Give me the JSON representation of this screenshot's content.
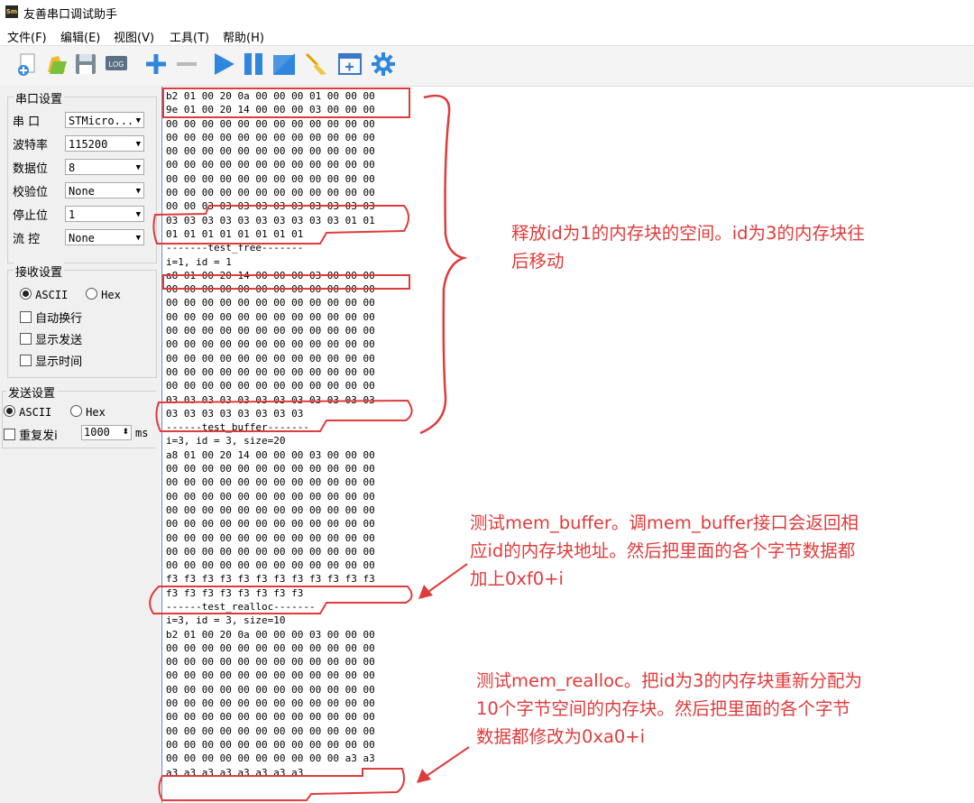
{
  "window": {
    "title": "友善串口调试助手",
    "icon_text": "Sm"
  },
  "menu": [
    "文件(F)",
    "编辑(E)",
    "视图(V)",
    "工具(T)",
    "帮助(H)"
  ],
  "toolbar": [
    "new-icon",
    "open-icon",
    "save-icon",
    "log-icon",
    "add-icon",
    "remove-icon",
    "play-icon",
    "pause-icon",
    "stop-icon",
    "clear-icon",
    "window-icon",
    "settings-icon"
  ],
  "toolbar_log_text": "LOG",
  "serial_settings": {
    "title": "串口设置",
    "rows": [
      {
        "label": "串  口",
        "value": "STMicro..."
      },
      {
        "label": "波特率",
        "value": "115200"
      },
      {
        "label": "数据位",
        "value": "8"
      },
      {
        "label": "校验位",
        "value": "None"
      },
      {
        "label": "停止位",
        "value": "1"
      },
      {
        "label": "流  控",
        "value": "None"
      }
    ]
  },
  "receive_settings": {
    "title": "接收设置",
    "ascii": "ASCII",
    "hex": "Hex",
    "auto_newline": "自动换行",
    "show_send": "显示发送",
    "show_time": "显示时间"
  },
  "send_settings": {
    "title": "发送设置",
    "ascii": "ASCII",
    "hex": "Hex",
    "repeat": "重复发i",
    "interval": "1000",
    "unit": "ms"
  },
  "output_lines": [
    "b2 01 00 20 0a 00 00 00 01 00 00 00",
    "9e 01 00 20 14 00 00 00 03 00 00 00",
    "00 00 00 00 00 00 00 00 00 00 00 00",
    "00 00 00 00 00 00 00 00 00 00 00 00",
    "00 00 00 00 00 00 00 00 00 00 00 00",
    "00 00 00 00 00 00 00 00 00 00 00 00",
    "00 00 00 00 00 00 00 00 00 00 00 00",
    "00 00 00 00 00 00 00 00 00 00 00 00",
    "00 00 03 03 03 03 03 03 03 03 03 03",
    "03 03 03 03 03 03 03 03 03 03 01 01",
    "01 01 01 01 01 01 01 01",
    "-------test_free-------",
    "i=1, id = 1",
    "a8 01 00 20 14 00 00 00 03 00 00 00",
    "00 00 00 00 00 00 00 00 00 00 00 00",
    "00 00 00 00 00 00 00 00 00 00 00 00",
    "00 00 00 00 00 00 00 00 00 00 00 00",
    "00 00 00 00 00 00 00 00 00 00 00 00",
    "00 00 00 00 00 00 00 00 00 00 00 00",
    "00 00 00 00 00 00 00 00 00 00 00 00",
    "00 00 00 00 00 00 00 00 00 00 00 00",
    "00 00 00 00 00 00 00 00 00 00 00 00",
    "03 03 03 03 03 03 03 03 03 03 03 03",
    "03 03 03 03 03 03 03 03",
    "------test_buffer-------",
    "i=3, id = 3, size=20",
    "a8 01 00 20 14 00 00 00 03 00 00 00",
    "00 00 00 00 00 00 00 00 00 00 00 00",
    "00 00 00 00 00 00 00 00 00 00 00 00",
    "00 00 00 00 00 00 00 00 00 00 00 00",
    "00 00 00 00 00 00 00 00 00 00 00 00",
    "00 00 00 00 00 00 00 00 00 00 00 00",
    "00 00 00 00 00 00 00 00 00 00 00 00",
    "00 00 00 00 00 00 00 00 00 00 00 00",
    "00 00 00 00 00 00 00 00 00 00 00 00",
    "f3 f3 f3 f3 f3 f3 f3 f3 f3 f3 f3 f3",
    "f3 f3 f3 f3 f3 f3 f3 f3",
    "------test_realloc-------",
    "i=3, id = 3, size=10",
    "b2 01 00 20 0a 00 00 00 03 00 00 00",
    "00 00 00 00 00 00 00 00 00 00 00 00",
    "00 00 00 00 00 00 00 00 00 00 00 00",
    "00 00 00 00 00 00 00 00 00 00 00 00",
    "00 00 00 00 00 00 00 00 00 00 00 00",
    "00 00 00 00 00 00 00 00 00 00 00 00",
    "00 00 00 00 00 00 00 00 00 00 00 00",
    "00 00 00 00 00 00 00 00 00 00 00 00",
    "00 00 00 00 00 00 00 00 00 00 00 00",
    "00 00 00 00 00 00 00 00 00 00 a3 a3",
    "a3 a3 a3 a3 a3 a3 a3 a3"
  ],
  "annotations": {
    "free": [
      "释放id为1的内存块的空间。id为3的内存块往",
      "后移动"
    ],
    "buffer": [
      "测试mem_buffer。调mem_buffer接口会返回相",
      "应id的内存块地址。然后把里面的各个字节数据都",
      "加上0xf0+i"
    ],
    "realloc": [
      "测试mem_realloc。把id为3的内存块重新分配为",
      "10个字节空间的内存块。然后把里面的各个字节",
      "数据都修改为0xa0+i"
    ]
  },
  "annotation_color": "#e03b3b"
}
